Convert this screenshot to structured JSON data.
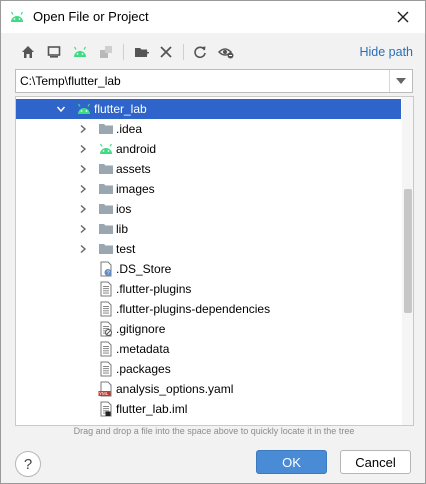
{
  "window": {
    "title": "Open File or Project"
  },
  "toolbar": {
    "buttons": [
      {
        "name": "home-icon"
      },
      {
        "name": "desktop-icon"
      },
      {
        "name": "android-project-icon"
      },
      {
        "name": "module-icon"
      },
      {
        "name": "new-folder-icon"
      },
      {
        "name": "delete-icon"
      },
      {
        "name": "refresh-icon"
      },
      {
        "name": "show-hidden-icon"
      }
    ],
    "hide_path_label": "Hide path"
  },
  "path": {
    "value": "C:\\Temp\\flutter_lab"
  },
  "tree": {
    "items": [
      {
        "label": "flutter_lab",
        "kind": "android",
        "expanded": true,
        "selected": true
      },
      {
        "label": ".idea",
        "kind": "folder"
      },
      {
        "label": "android",
        "kind": "android-folder"
      },
      {
        "label": "assets",
        "kind": "folder"
      },
      {
        "label": "images",
        "kind": "folder"
      },
      {
        "label": "ios",
        "kind": "folder"
      },
      {
        "label": "lib",
        "kind": "folder"
      },
      {
        "label": "test",
        "kind": "folder"
      },
      {
        "label": ".DS_Store",
        "kind": "unknown-file"
      },
      {
        "label": ".flutter-plugins",
        "kind": "text-file"
      },
      {
        "label": ".flutter-plugins-dependencies",
        "kind": "text-file"
      },
      {
        "label": ".gitignore",
        "kind": "ignore-file"
      },
      {
        "label": ".metadata",
        "kind": "text-file"
      },
      {
        "label": ".packages",
        "kind": "text-file"
      },
      {
        "label": "analysis_options.yaml",
        "kind": "yaml-file"
      },
      {
        "label": "flutter_lab.iml",
        "kind": "iml-file"
      }
    ]
  },
  "hint": "Drag and drop a file into the space above to quickly locate it in the tree",
  "buttons": {
    "help": "?",
    "ok": "OK",
    "cancel": "Cancel"
  },
  "colors": {
    "selection": "#2f65ca",
    "accent_link": "#2a6fb7",
    "android_green": "#3ddc84",
    "ok_button": "#4a8bd6"
  }
}
